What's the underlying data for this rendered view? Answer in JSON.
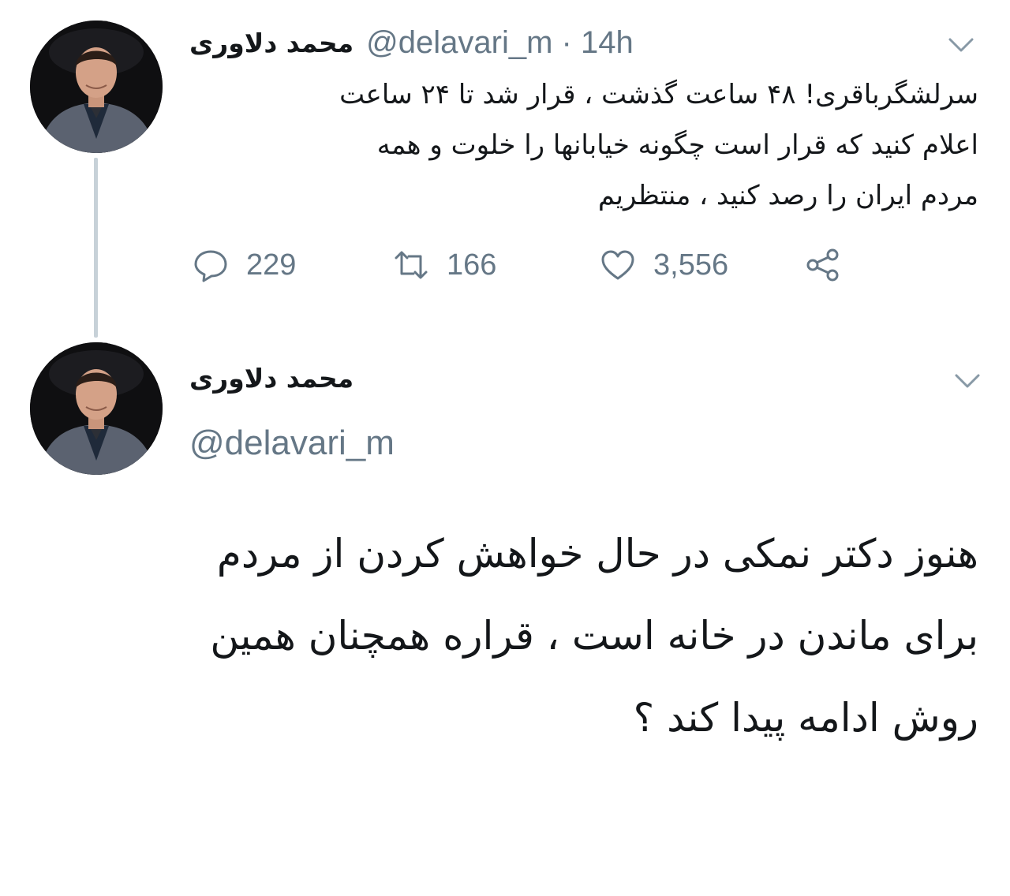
{
  "tweets": [
    {
      "display_name": "محمد دلاوری",
      "handle_time": "@delavari_m · 14h",
      "body_lines": [
        "سرلشگرباقری! ۴۸ ساعت گذشت ، قرار شد تا ۲۴ ساعت",
        "اعلام کنید که قرار است چگونه خیابانها را خلوت  و همه",
        "مردم ایران را رصد کنید ، منتظریم"
      ],
      "actions": {
        "replies": "229",
        "retweets": "166",
        "likes": "3,556"
      }
    },
    {
      "display_name": "محمد دلاوری",
      "handle": "@delavari_m",
      "body_lines": [
        "هنوز دکتر نمکی در حال خواهش کردن از مردم",
        "برای ماندن در خانه است ، قراره همچنان همین",
        "روش ادامه پیدا کند ؟"
      ]
    }
  ],
  "icons": {
    "reply": "reply-icon",
    "retweet": "retweet-icon",
    "like": "heart-icon",
    "share": "share-icon",
    "menu": "chevron-down-icon"
  },
  "colors": {
    "text": "#14171a",
    "secondary": "#657786",
    "thread_line": "#c7d1d8"
  }
}
